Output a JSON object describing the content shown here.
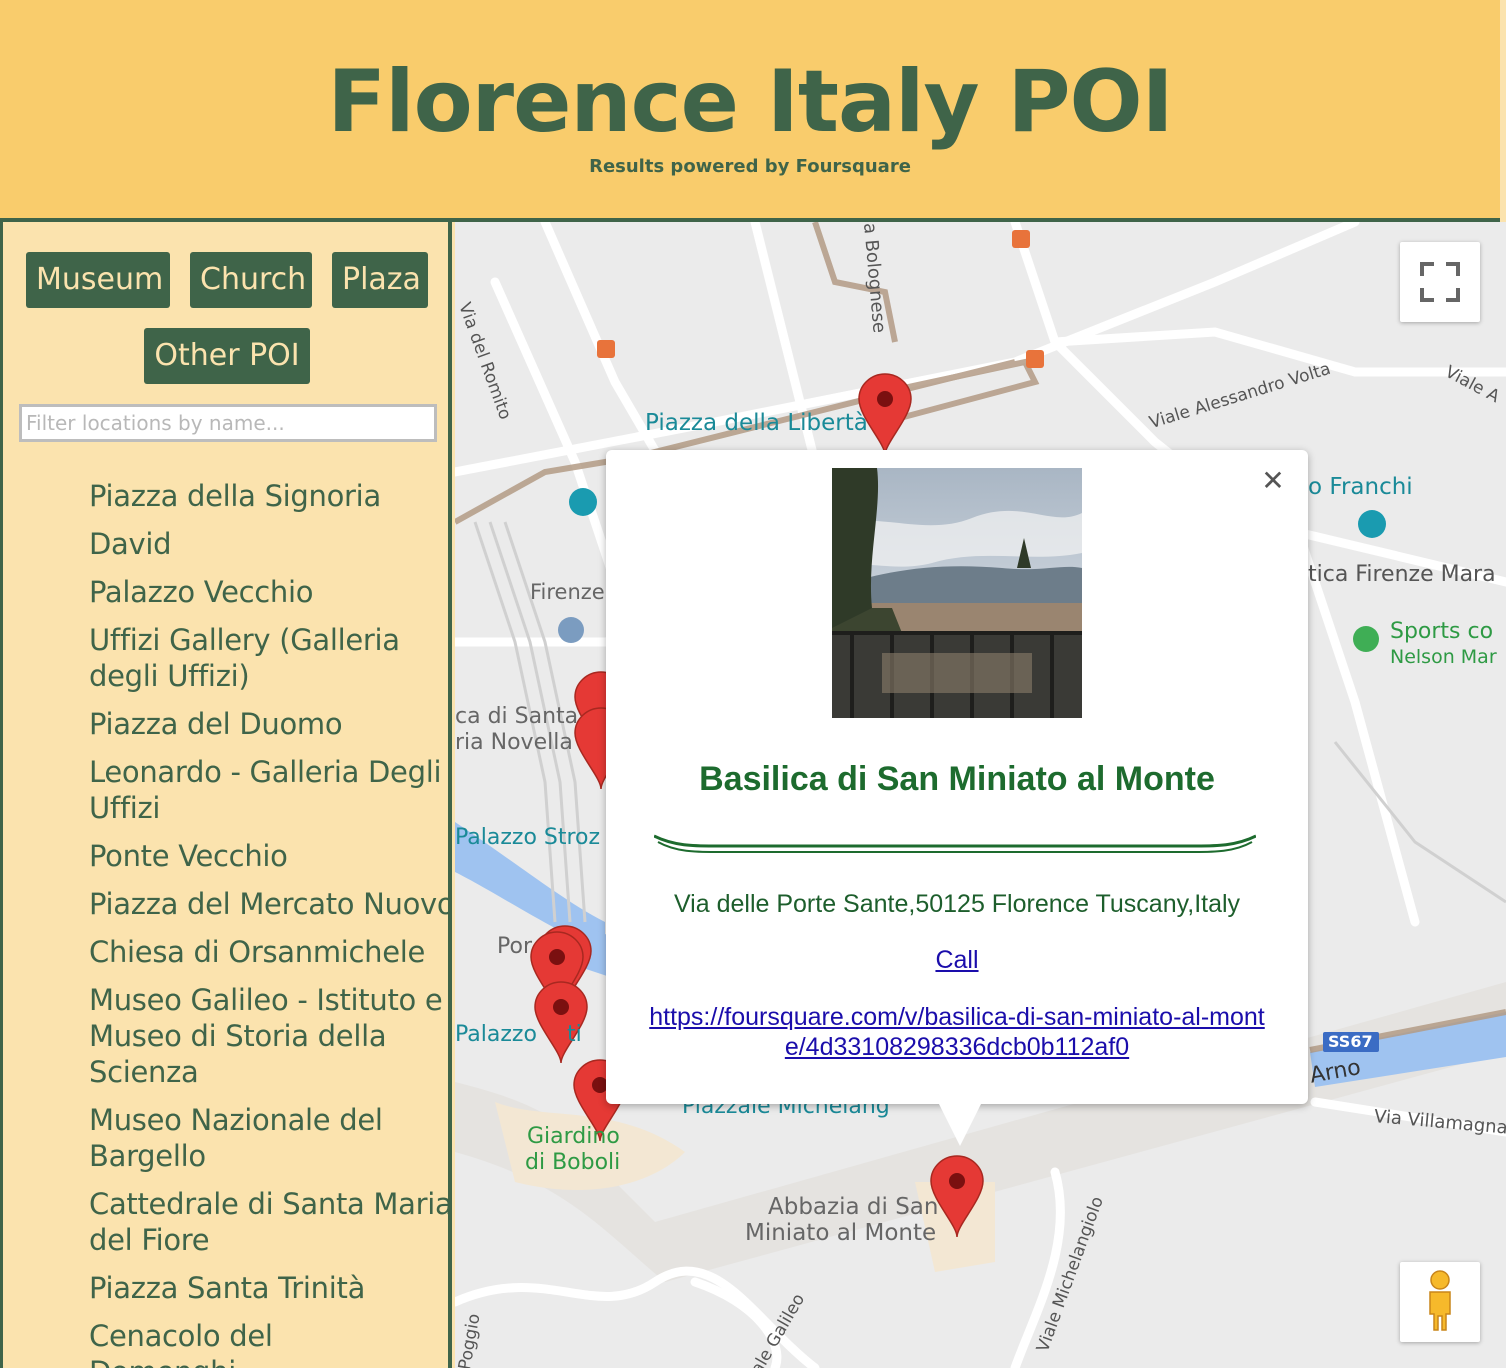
{
  "header": {
    "title": "Florence Italy POI",
    "subtitle": "Results powered by Foursquare"
  },
  "sidebar": {
    "category_buttons": [
      "Museum",
      "Church",
      "Plaza",
      "Other POI"
    ],
    "filter_placeholder": "Filter locations by name...",
    "locations": [
      "Piazza della Signoria",
      "David",
      "Palazzo Vecchio",
      "Uffizi Gallery (Galleria degli Uffizi)",
      "Piazza del Duomo",
      "Leonardo - Galleria Degli Uffizi",
      "Ponte Vecchio",
      "Piazza del Mercato Nuovo",
      "Chiesa di Orsanmichele",
      "Museo Galileo - Istituto e Museo di Storia della Scienza",
      "Museo Nazionale del Bargello",
      "Cattedrale di Santa Maria del Fiore",
      "Piazza Santa Trinità",
      "Cenacolo del Domenghi..."
    ]
  },
  "map": {
    "labels": {
      "piazza_liberta": "Piazza della Libertà",
      "via_romito": "Via del Romito",
      "bolognese": "a Bolognese",
      "viale_volta": "Viale Alessandro Volta",
      "viale_a": "Viale A",
      "franchi": "o Franchi",
      "firenze_mara": "tica Firenze Mara",
      "sports_1": "Sports co",
      "sports_2": "Nelson Mar",
      "firenze": "Firenze",
      "santa_1": "ca di Santa",
      "santa_2": "ria Novella",
      "palazzo_stroz": "Palazzo Stroz",
      "ponte": "Por",
      "palazzo_pitti": "Palazzo",
      "pitti_ti": "ti",
      "ss67": "SS67",
      "arno": "Arno",
      "via_villamagna": "Via Villamagna",
      "piazzale": "Piazzale Michelang",
      "giardino_1": "Giardino",
      "giardino_2": "di Boboli",
      "abbazia_1": "Abbazia di San",
      "abbazia_2": "Miniato al Monte",
      "viale_michelangiolo": "Viale Michelangiolo",
      "viale_galileo": "ale Galileo",
      "poggio": "Poggio"
    },
    "controls": {
      "fullscreen_icon": "fullscreen-icon",
      "pegman_icon": "pegman-icon"
    }
  },
  "infowindow": {
    "name": "Basilica di San Miniato al Monte",
    "address": "Via delle Porte Sante,50125 Florence Tuscany,Italy",
    "call_label": "Call",
    "url": "https://foursquare.com/v/basilica-di-san-miniato-al-monte/4d33108298336dcb0b112af0",
    "close_icon": "close-icon"
  },
  "colors": {
    "header_bg": "#f9cc6c",
    "sidebar_bg": "#fbe3ae",
    "brand_green": "#3f6449",
    "title_green": "#1d6b2e",
    "marker_red": "#e53935",
    "link_blue": "#1a0dab"
  }
}
